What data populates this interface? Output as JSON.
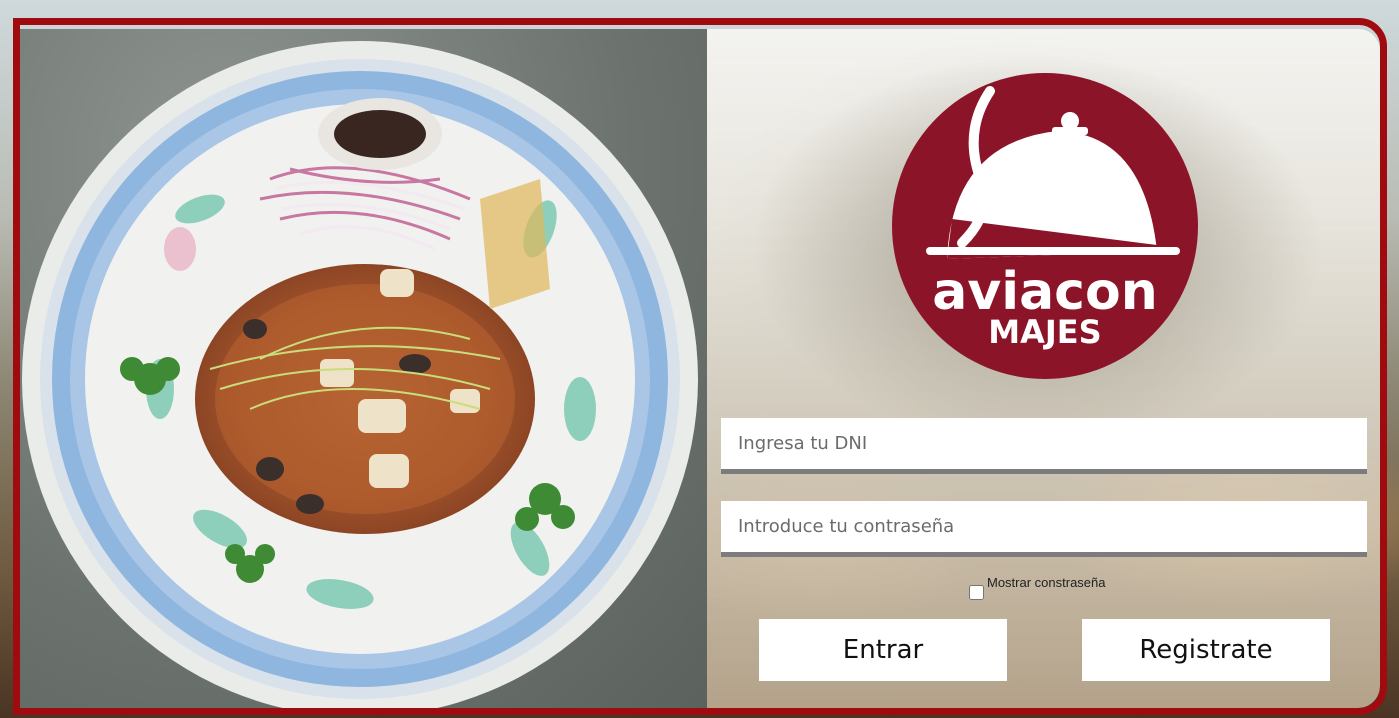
{
  "brand": {
    "name": "aviacon",
    "location": "MAJES",
    "color": "#8b1428"
  },
  "login": {
    "dni_placeholder": "Ingresa tu DNI",
    "password_placeholder": "Introduce tu contraseña",
    "show_password_label": "Mostrar constraseña",
    "enter_label": "Entrar",
    "register_label": "Registrate"
  },
  "colors": {
    "frame": "#a00b0f",
    "field_underline": "#7c7c7c"
  },
  "icons": {
    "logo": "cloche-icon"
  }
}
